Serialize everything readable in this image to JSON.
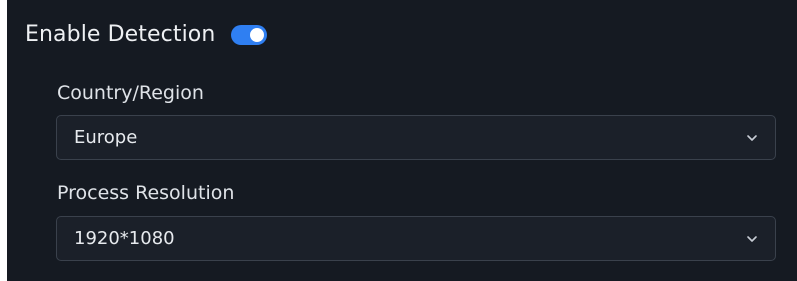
{
  "colors": {
    "panel_background": "#151a22",
    "toggle_accent": "#2f7ff2",
    "field_background": "#1b2029",
    "field_border": "#3a414c",
    "text_primary": "#eef0f3"
  },
  "detection": {
    "enable_label": "Enable Detection",
    "enabled": true,
    "toggle_icon": "toggle-switch-on"
  },
  "country_region": {
    "label": "Country/Region",
    "selected": "Europe",
    "icon": "chevron-down-icon"
  },
  "process_resolution": {
    "label": "Process Resolution",
    "selected": "1920*1080",
    "icon": "chevron-down-icon"
  }
}
